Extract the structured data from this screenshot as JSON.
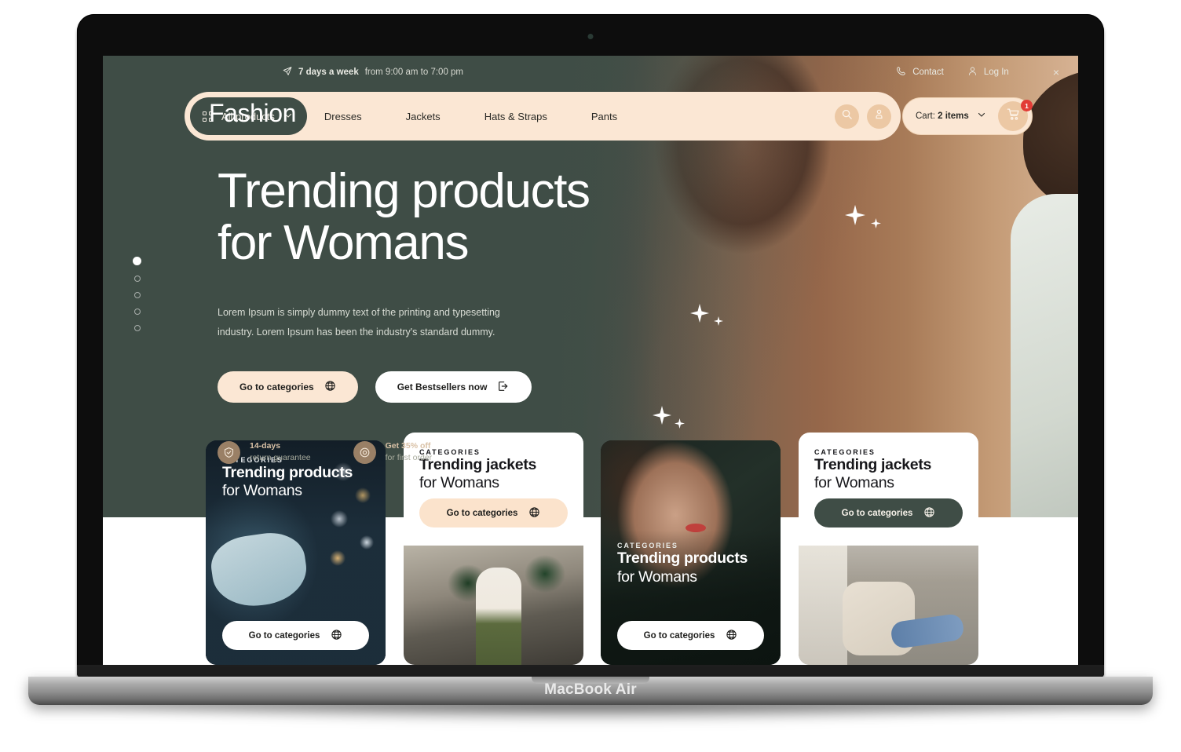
{
  "device": {
    "label": "MacBook Air"
  },
  "topbar": {
    "hours_strong": "7 days a week",
    "hours_rest": "from 9:00 am to 7:00 pm",
    "contact": "Contact",
    "login": "Log In",
    "close": "×",
    "plane_icon": "paper-plane-icon",
    "phone_icon": "phone-icon",
    "user_icon": "user-icon"
  },
  "header": {
    "brand": "Fashion",
    "dropdown_label": "All products",
    "nav": [
      {
        "label": "Dresses"
      },
      {
        "label": "Jackets"
      },
      {
        "label": "Hats & Straps"
      },
      {
        "label": "Pants"
      }
    ],
    "search_icon": "search-icon",
    "account_icon": "account-icon",
    "cart_prefix": "Cart: ",
    "cart_count_label": "2 items",
    "cart_badge": "1",
    "cart_icon": "shopping-cart-icon"
  },
  "hero": {
    "title_line1": "Trending products",
    "title_line2": "for Womans",
    "lead": "Lorem Ipsum is simply dummy text of the printing and typesetting industry. Lorem Ipsum has been the industry's standard dummy.",
    "cta_primary": "Go to categories",
    "cta_secondary": "Get Bestsellers now",
    "globe_icon": "globe-icon",
    "logout_icon": "arrow-out-of-box-icon",
    "features": [
      {
        "title": "14-days",
        "subtitle": "return guarantee",
        "icon": "shield-check-icon"
      },
      {
        "title": "Get 35% off",
        "subtitle": "for first order",
        "icon": "target-icon"
      }
    ],
    "carousel": {
      "total": 5,
      "active_index": 0
    }
  },
  "cards": [
    {
      "eyebrow": "CATEGORIES",
      "title": "Trending products",
      "subtitle": "for Womans",
      "button": "Go to categories",
      "button_style": "white"
    },
    {
      "eyebrow": "CATEGORIES",
      "title": "Trending jackets",
      "subtitle": "for Womans",
      "button": "Go to categories",
      "button_style": "peach"
    },
    {
      "eyebrow": "CATEGORIES",
      "title": "Trending products",
      "subtitle": "for Womans",
      "button": "Go to categories",
      "button_style": "white"
    },
    {
      "eyebrow": "CATEGORIES",
      "title": "Trending jackets",
      "subtitle": "for Womans",
      "button": "Go to categories",
      "button_style": "green"
    }
  ],
  "colors": {
    "green": "#3f4d46",
    "peach": "#fbe7d4",
    "peach_accent": "#ecc8a4",
    "badge_red": "#e23b36",
    "tan": "#9a8066",
    "white": "#ffffff"
  }
}
